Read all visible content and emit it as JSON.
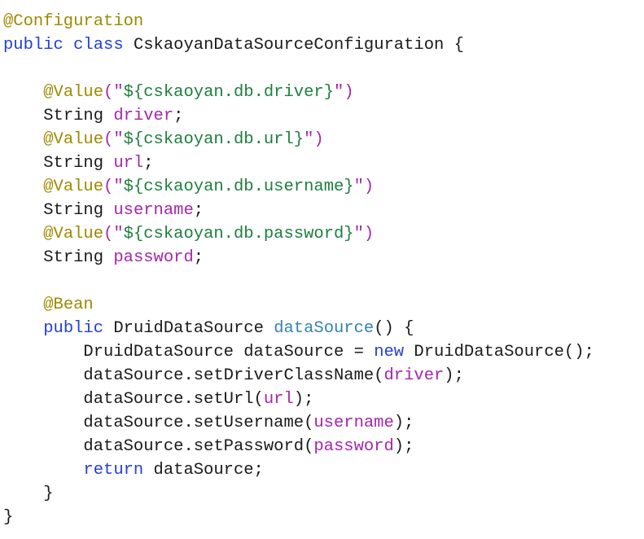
{
  "editor": {
    "background_color": "#ffffff",
    "font_size_px": 20.5,
    "line_height_px": 29,
    "language": "java"
  },
  "palette": {
    "plain": "#1a1a1a",
    "annotation": "#9d8a00",
    "keyword": "#2340d6",
    "string": "#1d7f3e",
    "field": "#a526ad",
    "method": "#3583ae",
    "punct": "#a526ad"
  },
  "code": {
    "lines": [
      {
        "number": 1,
        "indent": 0,
        "text": "@Configuration",
        "tokens": [
          {
            "t": "@Configuration",
            "k": "annotation"
          }
        ]
      },
      {
        "number": 2,
        "indent": 0,
        "text": "public class CskaoyanDataSourceConfiguration {",
        "tokens": [
          {
            "t": "public",
            "k": "keyword"
          },
          {
            "t": " ",
            "k": "plain"
          },
          {
            "t": "class",
            "k": "keyword"
          },
          {
            "t": " ",
            "k": "plain"
          },
          {
            "t": "CskaoyanDataSourceConfiguration",
            "k": "type"
          },
          {
            "t": " {",
            "k": "plain"
          }
        ]
      },
      {
        "number": 3,
        "indent": 0,
        "text": "",
        "tokens": []
      },
      {
        "number": 4,
        "indent": 4,
        "text": "@Value(\"${cskaoyan.db.driver}\")",
        "tokens": [
          {
            "t": "    ",
            "k": "plain"
          },
          {
            "t": "@Value",
            "k": "annotation"
          },
          {
            "t": "(",
            "k": "punct"
          },
          {
            "t": "\"",
            "k": "punct"
          },
          {
            "t": "${cskaoyan.db.driver}",
            "k": "string"
          },
          {
            "t": "\"",
            "k": "punct"
          },
          {
            "t": ")",
            "k": "punct"
          }
        ]
      },
      {
        "number": 5,
        "indent": 4,
        "text": "String driver;",
        "tokens": [
          {
            "t": "    ",
            "k": "plain"
          },
          {
            "t": "String",
            "k": "type"
          },
          {
            "t": " ",
            "k": "plain"
          },
          {
            "t": "driver",
            "k": "field"
          },
          {
            "t": ";",
            "k": "plain"
          }
        ]
      },
      {
        "number": 6,
        "indent": 4,
        "text": "@Value(\"${cskaoyan.db.url}\")",
        "tokens": [
          {
            "t": "    ",
            "k": "plain"
          },
          {
            "t": "@Value",
            "k": "annotation"
          },
          {
            "t": "(",
            "k": "punct"
          },
          {
            "t": "\"",
            "k": "punct"
          },
          {
            "t": "${cskaoyan.db.url}",
            "k": "string"
          },
          {
            "t": "\"",
            "k": "punct"
          },
          {
            "t": ")",
            "k": "punct"
          }
        ]
      },
      {
        "number": 7,
        "indent": 4,
        "text": "String url;",
        "tokens": [
          {
            "t": "    ",
            "k": "plain"
          },
          {
            "t": "String",
            "k": "type"
          },
          {
            "t": " ",
            "k": "plain"
          },
          {
            "t": "url",
            "k": "field"
          },
          {
            "t": ";",
            "k": "plain"
          }
        ]
      },
      {
        "number": 8,
        "indent": 4,
        "text": "@Value(\"${cskaoyan.db.username}\")",
        "tokens": [
          {
            "t": "    ",
            "k": "plain"
          },
          {
            "t": "@Value",
            "k": "annotation"
          },
          {
            "t": "(",
            "k": "punct"
          },
          {
            "t": "\"",
            "k": "punct"
          },
          {
            "t": "${cskaoyan.db.username}",
            "k": "string"
          },
          {
            "t": "\"",
            "k": "punct"
          },
          {
            "t": ")",
            "k": "punct"
          }
        ]
      },
      {
        "number": 9,
        "indent": 4,
        "text": "String username;",
        "tokens": [
          {
            "t": "    ",
            "k": "plain"
          },
          {
            "t": "String",
            "k": "type"
          },
          {
            "t": " ",
            "k": "plain"
          },
          {
            "t": "username",
            "k": "field"
          },
          {
            "t": ";",
            "k": "plain"
          }
        ]
      },
      {
        "number": 10,
        "indent": 4,
        "text": "@Value(\"${cskaoyan.db.password}\")",
        "tokens": [
          {
            "t": "    ",
            "k": "plain"
          },
          {
            "t": "@Value",
            "k": "annotation"
          },
          {
            "t": "(",
            "k": "punct"
          },
          {
            "t": "\"",
            "k": "punct"
          },
          {
            "t": "${cskaoyan.db.password}",
            "k": "string"
          },
          {
            "t": "\"",
            "k": "punct"
          },
          {
            "t": ")",
            "k": "punct"
          }
        ]
      },
      {
        "number": 11,
        "indent": 4,
        "text": "String password;",
        "tokens": [
          {
            "t": "    ",
            "k": "plain"
          },
          {
            "t": "String",
            "k": "type"
          },
          {
            "t": " ",
            "k": "plain"
          },
          {
            "t": "password",
            "k": "field"
          },
          {
            "t": ";",
            "k": "plain"
          }
        ]
      },
      {
        "number": 12,
        "indent": 0,
        "text": "",
        "tokens": []
      },
      {
        "number": 13,
        "indent": 4,
        "text": "@Bean",
        "tokens": [
          {
            "t": "    ",
            "k": "plain"
          },
          {
            "t": "@Bean",
            "k": "annotation"
          }
        ]
      },
      {
        "number": 14,
        "indent": 4,
        "text": "public DruidDataSource dataSource() {",
        "tokens": [
          {
            "t": "    ",
            "k": "plain"
          },
          {
            "t": "public",
            "k": "keyword"
          },
          {
            "t": " ",
            "k": "plain"
          },
          {
            "t": "DruidDataSource",
            "k": "type"
          },
          {
            "t": " ",
            "k": "plain"
          },
          {
            "t": "dataSource",
            "k": "method"
          },
          {
            "t": "() {",
            "k": "plain"
          }
        ]
      },
      {
        "number": 15,
        "indent": 8,
        "text": "DruidDataSource dataSource = new DruidDataSource();",
        "tokens": [
          {
            "t": "        ",
            "k": "plain"
          },
          {
            "t": "DruidDataSource dataSource = ",
            "k": "plain"
          },
          {
            "t": "new",
            "k": "keyword"
          },
          {
            "t": " DruidDataSource();",
            "k": "plain"
          }
        ]
      },
      {
        "number": 16,
        "indent": 8,
        "text": "dataSource.setDriverClassName(driver);",
        "tokens": [
          {
            "t": "        ",
            "k": "plain"
          },
          {
            "t": "dataSource.setDriverClassName(",
            "k": "plain"
          },
          {
            "t": "driver",
            "k": "field"
          },
          {
            "t": ");",
            "k": "plain"
          }
        ]
      },
      {
        "number": 17,
        "indent": 8,
        "text": "dataSource.setUrl(url);",
        "tokens": [
          {
            "t": "        ",
            "k": "plain"
          },
          {
            "t": "dataSource.setUrl(",
            "k": "plain"
          },
          {
            "t": "url",
            "k": "field"
          },
          {
            "t": ");",
            "k": "plain"
          }
        ]
      },
      {
        "number": 18,
        "indent": 8,
        "text": "dataSource.setUsername(username);",
        "tokens": [
          {
            "t": "        ",
            "k": "plain"
          },
          {
            "t": "dataSource.setUsername(",
            "k": "plain"
          },
          {
            "t": "username",
            "k": "field"
          },
          {
            "t": ");",
            "k": "plain"
          }
        ]
      },
      {
        "number": 19,
        "indent": 8,
        "text": "dataSource.setPassword(password);",
        "tokens": [
          {
            "t": "        ",
            "k": "plain"
          },
          {
            "t": "dataSource.setPassword(",
            "k": "plain"
          },
          {
            "t": "password",
            "k": "field"
          },
          {
            "t": ");",
            "k": "plain"
          }
        ]
      },
      {
        "number": 20,
        "indent": 8,
        "text": "return dataSource;",
        "tokens": [
          {
            "t": "        ",
            "k": "plain"
          },
          {
            "t": "return",
            "k": "keyword"
          },
          {
            "t": " dataSource;",
            "k": "plain"
          }
        ]
      },
      {
        "number": 21,
        "indent": 4,
        "text": "}",
        "tokens": [
          {
            "t": "    }",
            "k": "plain"
          }
        ]
      },
      {
        "number": 22,
        "indent": 0,
        "text": "}",
        "tokens": [
          {
            "t": "}",
            "k": "plain"
          }
        ]
      }
    ]
  }
}
